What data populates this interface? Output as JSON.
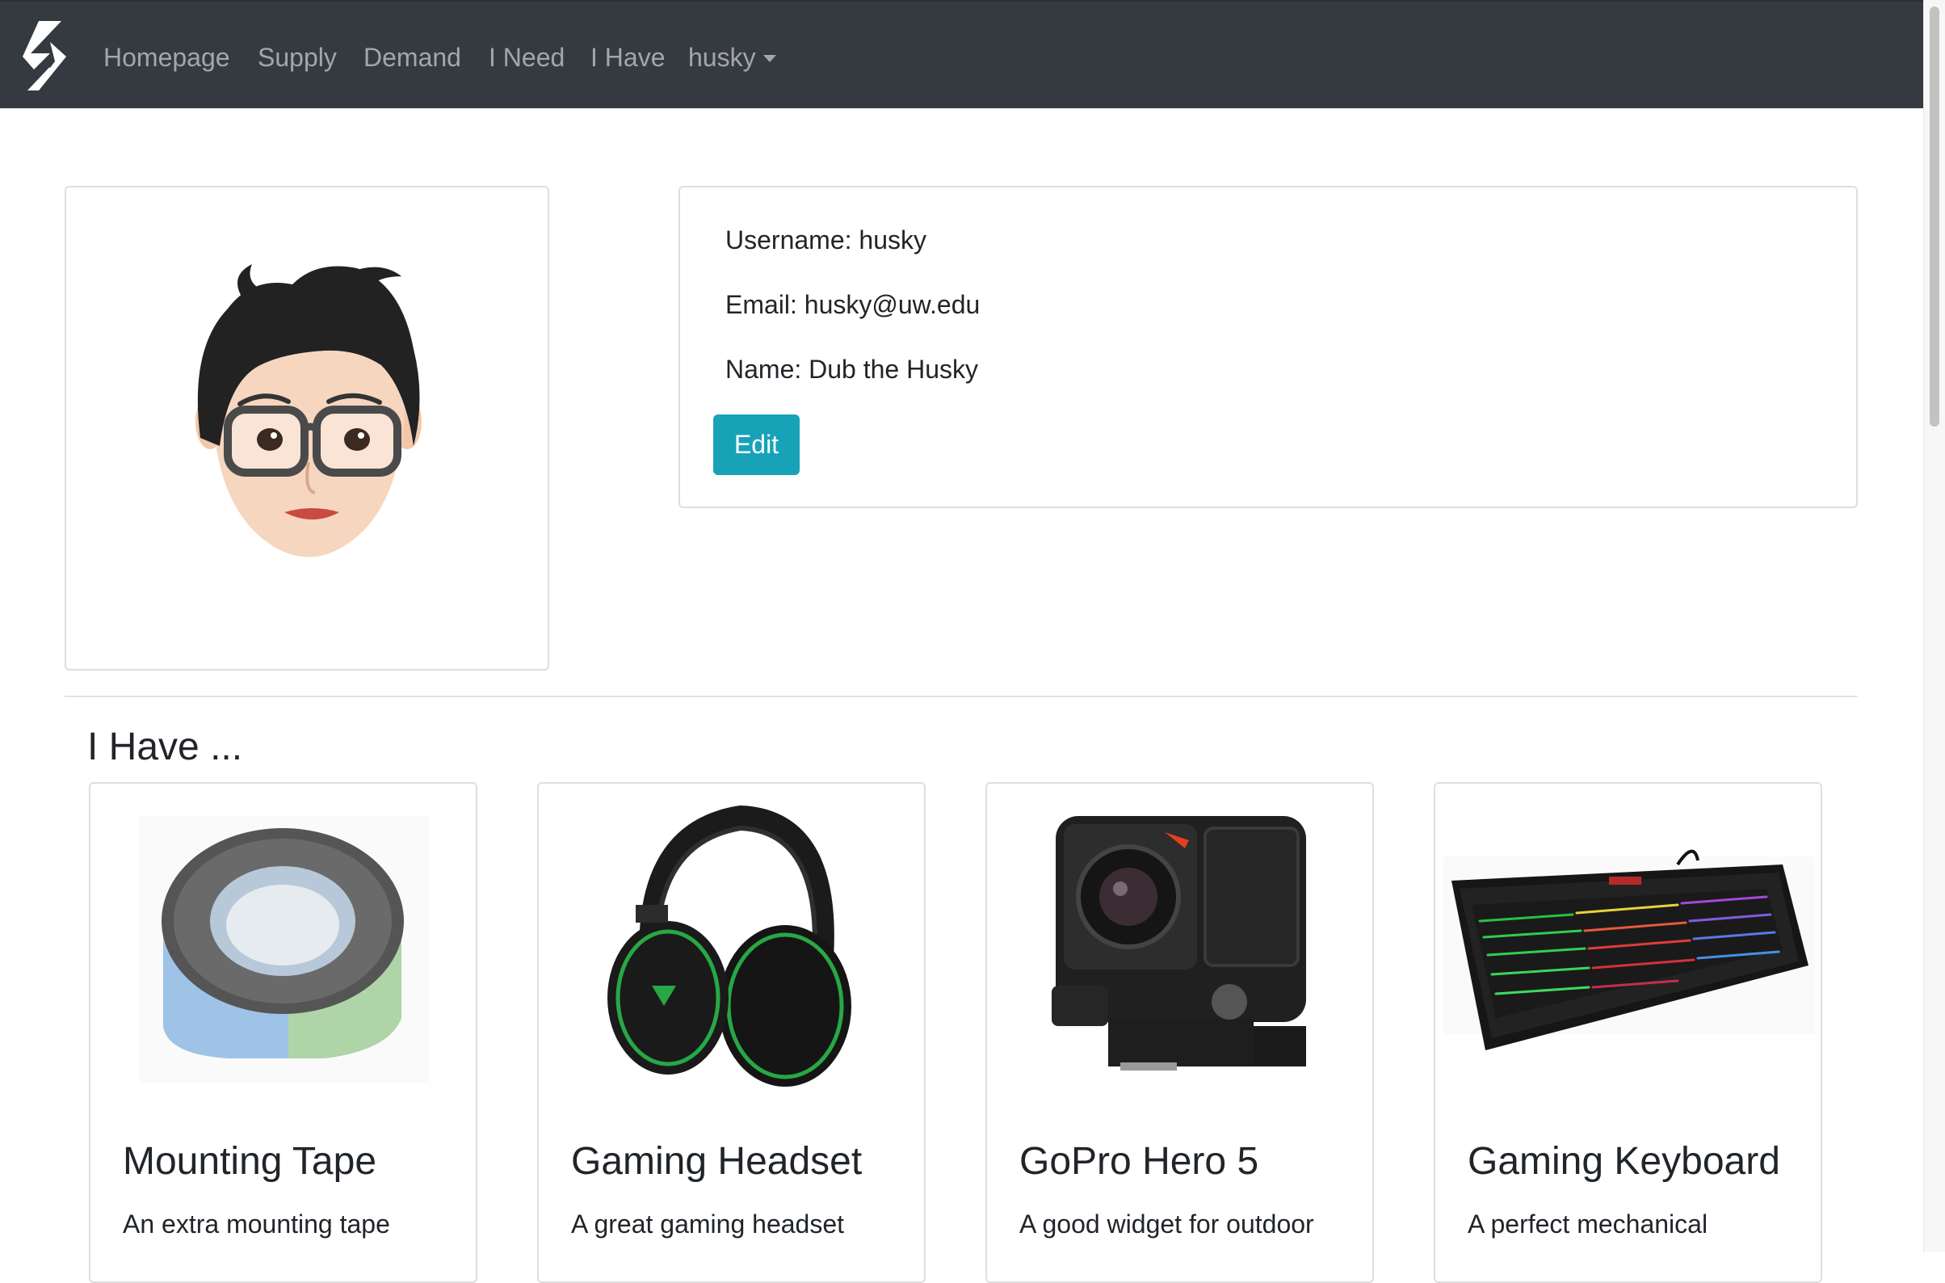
{
  "navbar": {
    "links": [
      "Homepage",
      "Supply",
      "Demand",
      "I Need",
      "I Have"
    ],
    "user_menu": "husky",
    "brand_icon": "s-logo-icon",
    "colors": {
      "background": "#343a40",
      "link": "rgba(255,255,255,0.55)"
    }
  },
  "profile": {
    "username_line": "Username: husky",
    "email_line": "Email: husky@uw.edu",
    "name_line": "Name: Dub the Husky",
    "edit_label": "Edit",
    "avatar_icon": "memoji-avatar",
    "edit_color": "#17a2b8"
  },
  "section": {
    "title": "I Have ..."
  },
  "items": [
    {
      "title": "Mounting Tape",
      "description": "An extra mounting tape",
      "image_icon": "tape-roll-image"
    },
    {
      "title": "Gaming Headset",
      "description": "A great gaming headset",
      "image_icon": "headset-image"
    },
    {
      "title": "GoPro Hero 5",
      "description": "A good widget for outdoor",
      "image_icon": "action-camera-image"
    },
    {
      "title": "Gaming Keyboard",
      "description": "A perfect mechanical",
      "image_icon": "keyboard-image"
    }
  ]
}
